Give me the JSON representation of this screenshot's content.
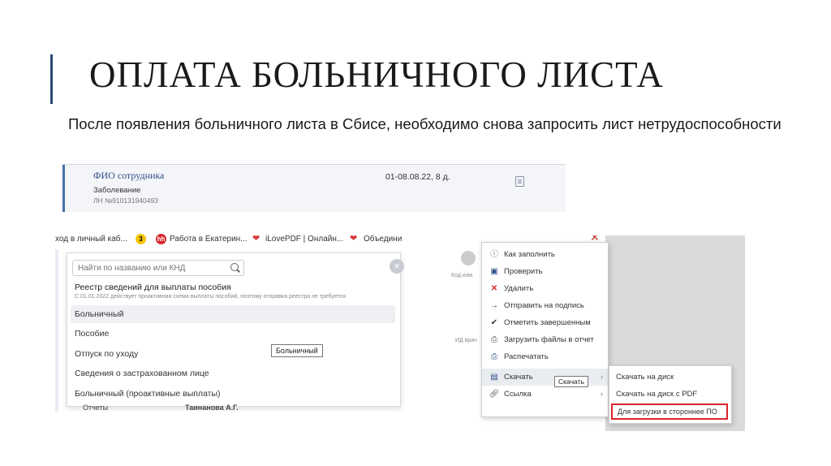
{
  "slide": {
    "title": "ОПЛАТА БОЛЬНИЧНОГО ЛИСТА",
    "subtitle": "После появления больничного листа в Сбисе, необходимо снова запросить лист нетрудоспособности"
  },
  "shot1": {
    "employee": "ФИО сотрудника",
    "dates": "01-08.08.22, 8 д.",
    "reason": "Заболевание",
    "ln_number": "ЛН №910131940493"
  },
  "shot2": {
    "bookmarks": [
      {
        "label": "ход в личный каб...",
        "icon": "none"
      },
      {
        "label": "",
        "icon": "badge-3",
        "badge": "3"
      },
      {
        "label": "Работа в Екатерин...",
        "icon": "hh-logo",
        "badge": "hh"
      },
      {
        "label": "iLovePDF | Онлайн...",
        "icon": "heart-icon"
      },
      {
        "label": "Объедини",
        "icon": "heart-icon"
      }
    ],
    "search_placeholder": "Найти по названию или КНД",
    "registry_title": "Реестр сведений для выплаты пособия",
    "registry_note": "С 01.01.2022 действует проактивная схема выплаты пособий, поэтому отправка реестра не требуется",
    "items": [
      "Больничный",
      "Пособие",
      "Отпуск по уходу",
      "Сведения о застрахованном лице",
      "Больничный (проактивные выплаты)"
    ],
    "tooltip": "Больничный",
    "behind_left": "Отчеты",
    "behind_right": "Таинанова А.Г."
  },
  "shot3": {
    "bg_labels": [
      "Код изм.",
      "ИД врач"
    ],
    "menu": [
      {
        "label": "Как заполнить",
        "icon": "question-icon",
        "color": "#666666"
      },
      {
        "label": "Проверить",
        "icon": "clipboard-check-icon",
        "color": "#2b4f86"
      },
      {
        "label": "Удалить",
        "icon": "delete-x-icon",
        "color": "#d9252a"
      },
      {
        "label": "Отправить на подпись",
        "icon": "arrow-right-icon",
        "color": "#333333"
      },
      {
        "label": "Отметить завершенным",
        "icon": "checkmark-icon",
        "color": "#333333"
      },
      {
        "label": "Загрузить файлы в отчет",
        "icon": "paperclip-icon",
        "color": "#555555"
      },
      {
        "label": "Распечатать",
        "icon": "printer-icon",
        "color": "#2b4f86"
      },
      {
        "label": "Скачать",
        "icon": "save-icon",
        "color": "#2b4f86"
      },
      {
        "label": "Ссылка",
        "icon": "link-icon",
        "color": "#555555"
      }
    ],
    "tooltip": "Скачать",
    "submenu": [
      "Скачать на диск",
      "Скачать на диск с PDF",
      "Для загрузки в стороннее ПО"
    ],
    "highlight_color": "#d9252a"
  }
}
